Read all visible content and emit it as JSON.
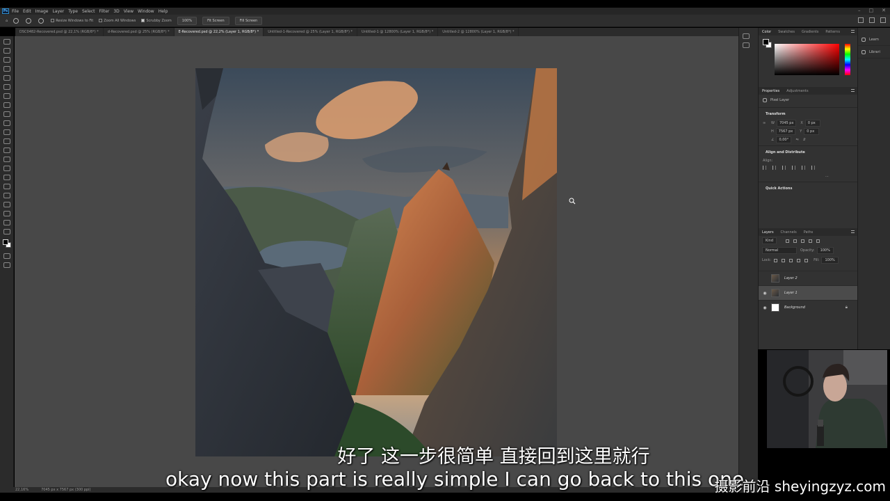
{
  "menubar": {
    "logo": "Ps",
    "items": [
      "File",
      "Edit",
      "Image",
      "Layer",
      "Type",
      "Select",
      "Filter",
      "3D",
      "View",
      "Window",
      "Help"
    ]
  },
  "options_bar": {
    "resize_windows": "Resize Windows to Fit",
    "zoom_all": "Zoom All Windows",
    "scrubby_zoom": "Scrubby Zoom",
    "zoom_level": "100%",
    "fit_screen": "Fit Screen",
    "fill_screen": "Fill Screen"
  },
  "document_tabs": [
    {
      "label": "DSC0482-Recovered.psd @ 22,1% (RGB/8*) *",
      "active": false
    },
    {
      "label": "d-Recovered.psd @ 25% (RGB/8*) *",
      "active": false
    },
    {
      "label": "E-Recovered.psd @ 22,2% (Layer 1, RGB/8*) *",
      "active": true
    },
    {
      "label": "Untitled-1-Recovered @ 25% (Layer 1, RGB/8*) *",
      "active": false
    },
    {
      "label": "Untitled-1 @ 12800% (Layer 1, RGB/8*) *",
      "active": false
    },
    {
      "label": "Untitled-2 @ 12800% (Layer 1, RGB/8*) *",
      "active": false
    }
  ],
  "status_bar": {
    "zoom": "22,16%",
    "doc_size": "7045 px x 7567 px (300 ppi)"
  },
  "color_panel": {
    "tabs": [
      "Color",
      "Swatches",
      "Gradients",
      "Patterns"
    ]
  },
  "properties_panel": {
    "tabs": [
      "Properties",
      "Adjustments"
    ],
    "layer_type": "Pixel Layer",
    "transform_title": "Transform",
    "w_label": "W",
    "w_value": "7045 px",
    "h_label": "H",
    "h_value": "7567 px",
    "x_label": "X",
    "x_value": "0 px",
    "y_label": "Y",
    "y_value": "0 px",
    "angle_value": "0,00°",
    "align_title": "Align and Distribute",
    "align_label": "Align:",
    "more": "...",
    "quick_actions": "Quick Actions"
  },
  "layers_panel": {
    "tabs": [
      "Layers",
      "Channels",
      "Paths"
    ],
    "filter_kind": "Kind",
    "blend_mode": "Normal",
    "opacity_label": "Opacity:",
    "opacity_value": "100%",
    "lock_label": "Lock:",
    "fill_label": "Fill:",
    "fill_value": "100%",
    "layers": [
      {
        "name": "Layer 2",
        "visible": false,
        "selected": false
      },
      {
        "name": "Layer 1",
        "visible": true,
        "selected": true
      },
      {
        "name": "Background",
        "visible": true,
        "selected": false
      }
    ]
  },
  "learn_panel": {
    "learn": "Learn",
    "libraries": "Librari"
  },
  "subtitles": {
    "chinese": "好了 这一步很简单 直接回到这里就行",
    "english": "okay now this part is really simple I can go back to this one"
  },
  "watermark": "摄影前沿 sheyingzyz.com",
  "colors": {
    "app_bg": "#484848",
    "panel_bg": "#323232",
    "accent": "#2f8fd0"
  }
}
